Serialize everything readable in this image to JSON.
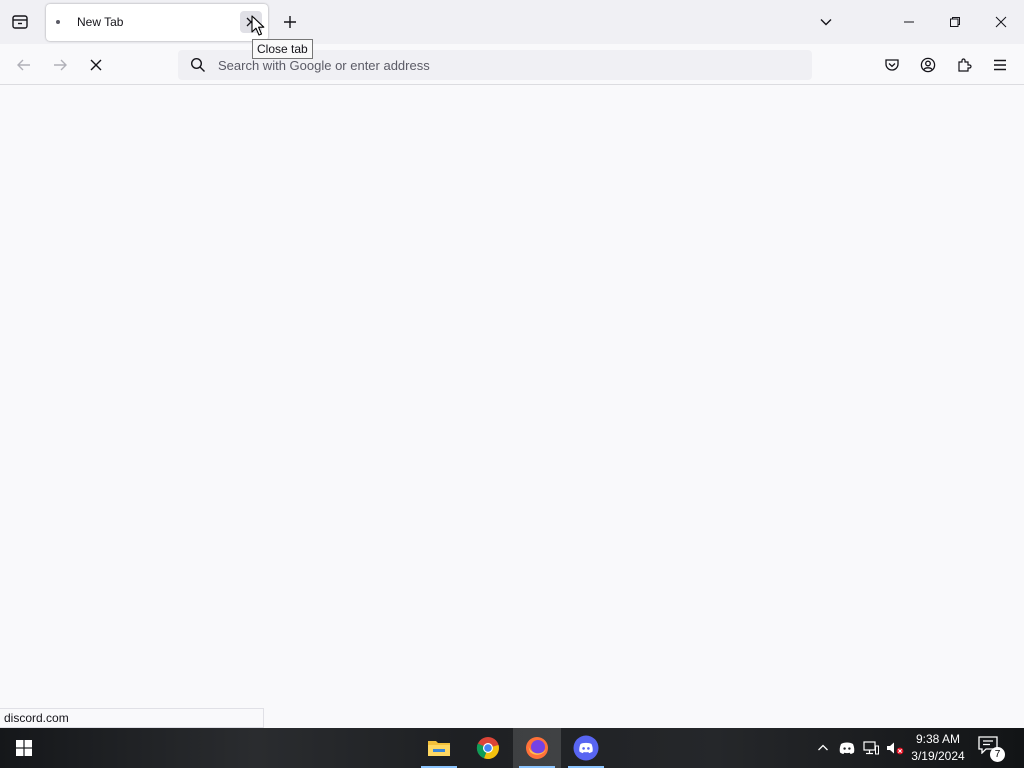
{
  "browser": {
    "tab": {
      "title": "New Tab",
      "close_tooltip": "Close tab"
    },
    "urlbar": {
      "placeholder": "Search with Google or enter address",
      "value": ""
    },
    "status_text": "discord.com"
  },
  "taskbar": {
    "pinned": [
      "file-explorer-icon",
      "chrome-icon",
      "firefox-icon",
      "discord-icon"
    ],
    "active_app": "firefox",
    "clock": {
      "time": "9:38 AM",
      "date": "3/19/2024"
    },
    "notification_count": "7"
  },
  "colors": {
    "accent": "#8cc5ff",
    "discord": "#5865f2",
    "mute_badge": "#e81123"
  }
}
